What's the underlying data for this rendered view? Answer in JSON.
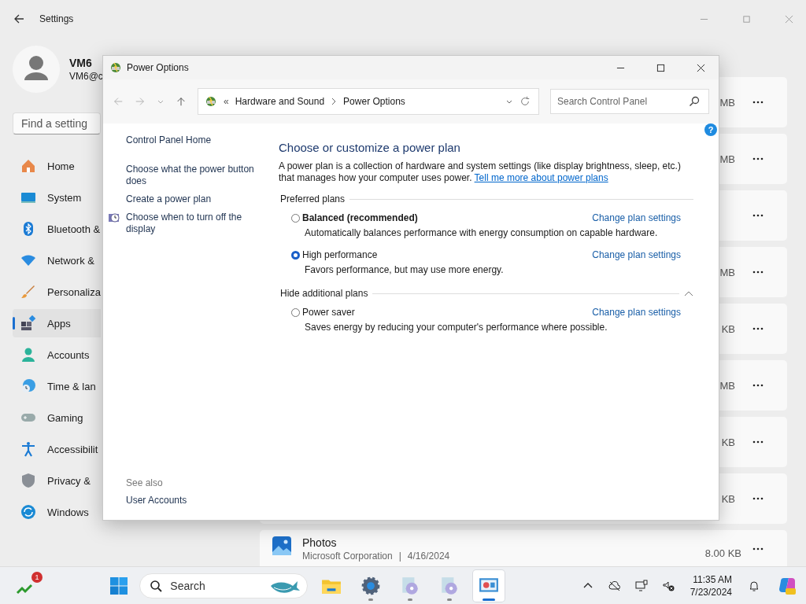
{
  "settings": {
    "title": "Settings",
    "user": {
      "name": "VM6",
      "email": "VM6@c"
    },
    "search": {
      "placeholder": "Find a setting"
    },
    "nav": [
      {
        "label": "Home",
        "kind": "home",
        "selected": false
      },
      {
        "label": "System",
        "kind": "system",
        "selected": false
      },
      {
        "label": "Bluetooth &",
        "kind": "bluetooth",
        "selected": false
      },
      {
        "label": "Network &",
        "kind": "network",
        "selected": false
      },
      {
        "label": "Personaliza",
        "kind": "personalization",
        "selected": false
      },
      {
        "label": "Apps",
        "kind": "apps",
        "selected": true
      },
      {
        "label": "Accounts",
        "kind": "accounts",
        "selected": false
      },
      {
        "label": "Time & lan",
        "kind": "time",
        "selected": false
      },
      {
        "label": "Gaming",
        "kind": "gaming",
        "selected": false
      },
      {
        "label": "Accessibilit",
        "kind": "accessibility",
        "selected": false
      },
      {
        "label": "Privacy &",
        "kind": "privacy",
        "selected": false
      },
      {
        "label": "Windows",
        "kind": "update",
        "selected": false
      }
    ],
    "app_cards": [
      {
        "kind": "app",
        "size": "MB"
      },
      {
        "kind": "app",
        "size": "MB"
      },
      {
        "kind": "app"
      },
      {
        "kind": "app",
        "size": "MB"
      },
      {
        "kind": "app",
        "size": "KB"
      },
      {
        "kind": "app",
        "size": "MB"
      },
      {
        "kind": "app",
        "size": "KB"
      },
      {
        "kind": "app",
        "size": "KB"
      }
    ],
    "last_app": {
      "name": "Photos",
      "publisher": "Microsoft Corporation",
      "separator": "|",
      "date": "4/16/2024",
      "size": "8.00 KB"
    }
  },
  "window": {
    "title": "Power Options",
    "address": {
      "prefix": "«",
      "crumbs": [
        "Hardware and Sound",
        "Power Options"
      ]
    },
    "search": {
      "placeholder": "Search Control Panel"
    },
    "help": "?",
    "sidebar": {
      "links": [
        {
          "label": "Control Panel Home",
          "kind": "link"
        },
        {
          "label": "Choose what the power button does",
          "kind": "link"
        },
        {
          "label": "Create a power plan",
          "kind": "link"
        },
        {
          "label": "Choose when to turn off the display",
          "kind": "icon_link"
        }
      ],
      "see_also": {
        "title": "See also",
        "links": [
          "User Accounts"
        ]
      }
    },
    "main": {
      "heading": "Choose or customize a power plan",
      "description": "A power plan is a collection of hardware and system settings (like display brightness, sleep, etc.) that manages how your computer uses power.",
      "link": "Tell me more about power plans",
      "sections": [
        {
          "title": "Preferred plans",
          "plans": [
            {
              "name": "Balanced (recommended)",
              "recommended": true,
              "selected": false,
              "description": "Automatically balances performance with energy consumption on capable hardware.",
              "action": "Change plan settings"
            },
            {
              "name": "High performance",
              "recommended": false,
              "selected": true,
              "description": "Favors performance, but may use more energy.",
              "action": "Change plan settings"
            }
          ]
        },
        {
          "title": "Hide additional plans",
          "expanded": true,
          "plans": [
            {
              "name": "Power saver",
              "recommended": false,
              "selected": false,
              "description": "Saves energy by reducing your computer's performance where possible.",
              "action": "Change plan settings"
            }
          ]
        }
      ]
    }
  },
  "taskbar": {
    "widget_badge": "1",
    "search": {
      "placeholder": "Search"
    },
    "apps": [
      {
        "kind": "explorer",
        "running": false,
        "active": false
      },
      {
        "kind": "settings",
        "running": true,
        "active": false
      },
      {
        "kind": "disc",
        "running": true,
        "active": false
      },
      {
        "kind": "disc",
        "running": true,
        "active": false
      },
      {
        "kind": "control_panel",
        "running": true,
        "active": true
      }
    ],
    "time": "11:35 AM",
    "date": "7/23/2024"
  }
}
